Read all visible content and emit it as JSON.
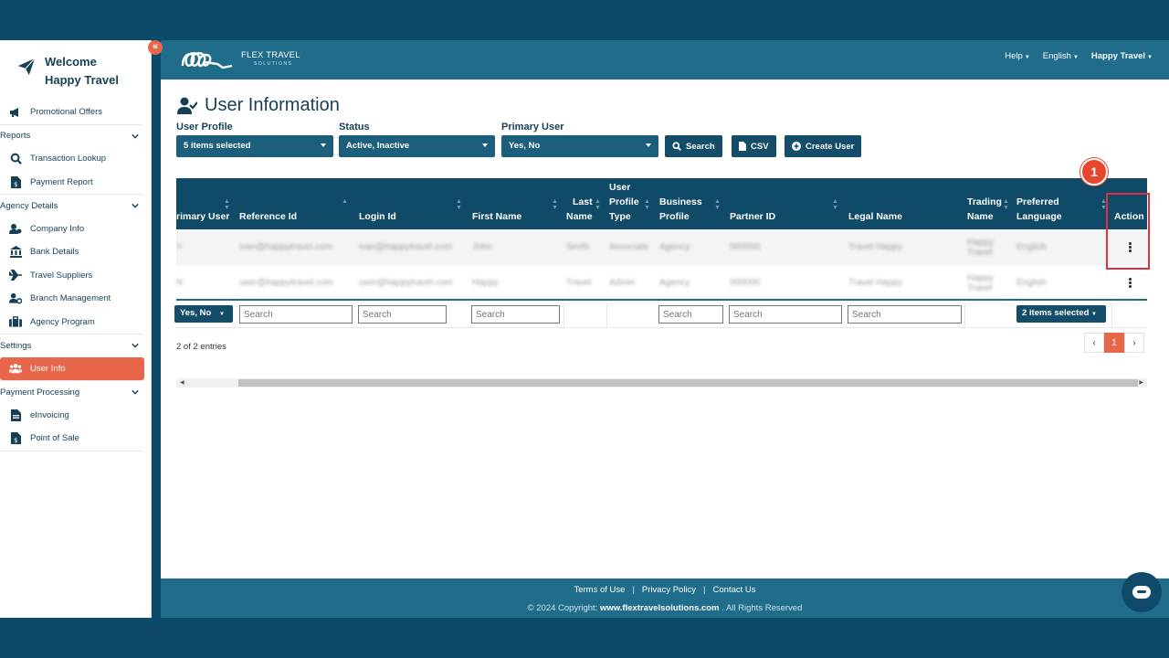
{
  "sidebar": {
    "welcome_line1": "Welcome",
    "welcome_line2": "Happy Travel",
    "collapse_glyph": "«",
    "items": [
      {
        "label": "Promotional Offers",
        "icon": "megaphone-icon"
      },
      {
        "label": "Reports",
        "section": true
      },
      {
        "label": "Transaction Lookup",
        "icon": "search-icon"
      },
      {
        "label": "Payment Report",
        "icon": "file-dollar-icon"
      },
      {
        "label": "Agency Details",
        "section": true
      },
      {
        "label": "Company Info",
        "icon": "users-cog-icon"
      },
      {
        "label": "Bank Details",
        "icon": "bank-icon"
      },
      {
        "label": "Travel Suppliers",
        "icon": "plane-icon"
      },
      {
        "label": "Branch Management",
        "icon": "user-gear-icon"
      },
      {
        "label": "Agency Program",
        "icon": "briefcase-icon"
      },
      {
        "label": "Settings",
        "section": true
      },
      {
        "label": "User Info",
        "icon": "users-icon",
        "active": true
      },
      {
        "label": "Payment Processing",
        "section": true
      },
      {
        "label": "eInvoicing",
        "icon": "invoice-icon"
      },
      {
        "label": "Point of Sale",
        "icon": "file-dollar-icon"
      }
    ]
  },
  "header": {
    "brand": "FLEX TRAVEL",
    "brand_sub": "SOLUTIONS",
    "help": "Help",
    "language": "English",
    "user": "Happy Travel"
  },
  "main": {
    "title": "User Information",
    "filters": [
      {
        "label": "User Profile",
        "value": "5 items selected"
      },
      {
        "label": "Status",
        "value": "Active, Inactive"
      },
      {
        "label": "Primary User",
        "value": "Yes, No"
      }
    ],
    "buttons": {
      "search": "Search",
      "csv": "CSV",
      "create_user": "Create User"
    },
    "table": {
      "headers": {
        "primary_user": "rimary User",
        "reference_id": "Reference Id",
        "login_id": "Login Id",
        "first_name": "First Name",
        "last_name_1": "Last",
        "last_name_2": "Name",
        "user_profile_type_1": "User",
        "user_profile_type_2": "Profile",
        "user_profile_type_3": "Type",
        "business_profile_1": "Business",
        "business_profile_2": "Profile",
        "partner_id": "Partner ID",
        "legal_name": "Legal Name",
        "trading_name_1": "Trading",
        "trading_name_2": "Name",
        "preferred_language_1": "Preferred",
        "preferred_language_2": "Language",
        "action": "Action"
      },
      "rows": [
        {
          "primary": "Y",
          "ref": "ivan@happytravel.com",
          "login": "ivan@happytravel.com",
          "first": "John",
          "last": "Smith",
          "type": "Associate",
          "business": "Agency",
          "partner": "000000",
          "legal": "Travel Happy",
          "trading": "Happy Travel",
          "language": "English"
        },
        {
          "primary": "N",
          "ref": "user@happytravel.com",
          "login": "user@happytravel.com",
          "first": "Happy",
          "last": "Travel",
          "type": "Admin",
          "business": "Agency",
          "partner": "000000",
          "legal": "Travel Happy",
          "trading": "Happy Travel",
          "language": "English"
        }
      ],
      "filter_row": {
        "primary_user": "Yes, No",
        "search_placeholder": "Search",
        "language": "2 items selected"
      }
    },
    "entries": "2 of 2 entries",
    "pager": {
      "prev": "‹",
      "current": "1",
      "next": "›"
    },
    "step_badge": "1"
  },
  "footer": {
    "terms": "Terms of Use",
    "privacy": "Privacy Policy",
    "contact": "Contact Us",
    "sep": "|",
    "copy_prefix": "© 2024 Copyright: ",
    "copy_site": "www.flextravelsolutions.com",
    "copy_suffix": " . All Rights Reserved"
  },
  "colors": {
    "navy": "#0f4a68",
    "header_teal": "#1f6d8a",
    "accent_orange": "#e8674a",
    "highlight_red": "#e0323c"
  }
}
